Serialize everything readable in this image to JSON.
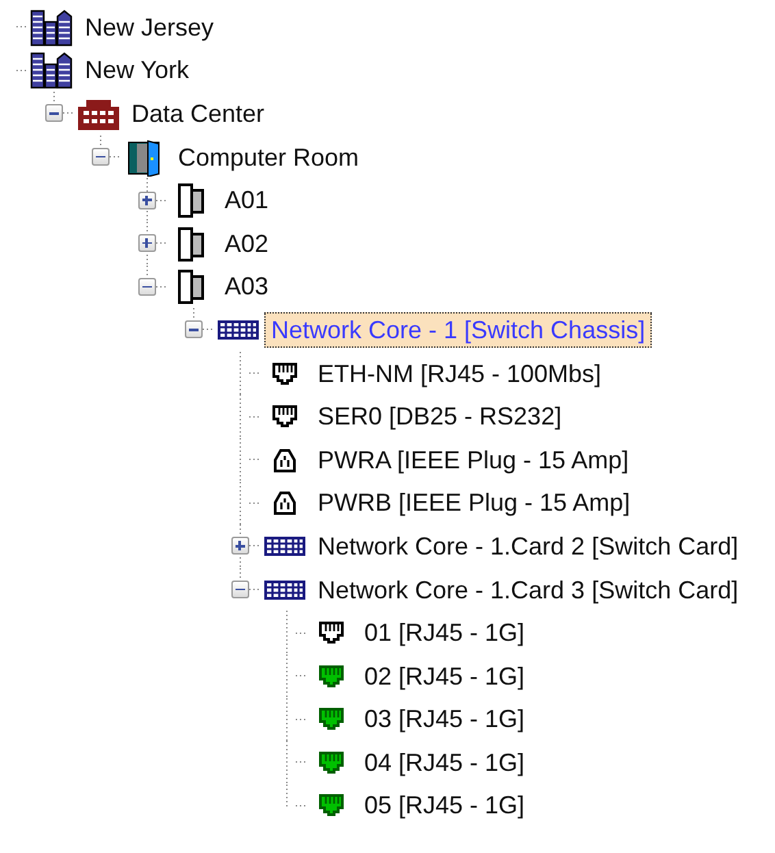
{
  "tree": [
    {
      "label": "New Jersey",
      "kind": "city",
      "selected": false
    },
    {
      "label": "New York",
      "kind": "city",
      "selected": false,
      "children": [
        {
          "label": "Data Center",
          "kind": "site",
          "selected": false,
          "expanded": true,
          "children": [
            {
              "label": "Computer Room",
              "kind": "room",
              "selected": false,
              "expanded": true,
              "children": [
                {
                  "label": "A01",
                  "kind": "rack",
                  "selected": false,
                  "expanded": false
                },
                {
                  "label": "A02",
                  "kind": "rack",
                  "selected": false,
                  "expanded": false
                },
                {
                  "label": "A03",
                  "kind": "rack",
                  "selected": false,
                  "expanded": true,
                  "children": [
                    {
                      "label": "Network Core - 1 [Switch Chassis]",
                      "kind": "chassis",
                      "selected": true,
                      "expanded": true,
                      "children": [
                        {
                          "label": "ETH-NM [RJ45 - 100Mbs]",
                          "kind": "port",
                          "selected": false,
                          "connected": false
                        },
                        {
                          "label": "SER0 [DB25 - RS232]",
                          "kind": "port",
                          "selected": false,
                          "connected": false
                        },
                        {
                          "label": "PWRA [IEEE Plug - 15 Amp]",
                          "kind": "power",
                          "selected": false
                        },
                        {
                          "label": "PWRB [IEEE Plug - 15 Amp]",
                          "kind": "power",
                          "selected": false
                        },
                        {
                          "label": "Network Core - 1.Card 2 [Switch Card]",
                          "kind": "card",
                          "selected": false,
                          "expanded": false
                        },
                        {
                          "label": "Network Core - 1.Card 3 [Switch Card]",
                          "kind": "card",
                          "selected": false,
                          "expanded": true,
                          "children": [
                            {
                              "label": "01 [RJ45 - 1G]",
                              "kind": "port",
                              "selected": false,
                              "connected": false
                            },
                            {
                              "label": "02 [RJ45 - 1G]",
                              "kind": "port",
                              "selected": false,
                              "connected": true
                            },
                            {
                              "label": "03 [RJ45 - 1G]",
                              "kind": "port",
                              "selected": false,
                              "connected": true
                            },
                            {
                              "label": "04 [RJ45 - 1G]",
                              "kind": "port",
                              "selected": false,
                              "connected": true
                            },
                            {
                              "label": "05 [RJ45 - 1G]",
                              "kind": "port",
                              "selected": false,
                              "connected": true
                            }
                          ]
                        }
                      ]
                    }
                  ]
                }
              ]
            }
          ]
        }
      ]
    }
  ]
}
